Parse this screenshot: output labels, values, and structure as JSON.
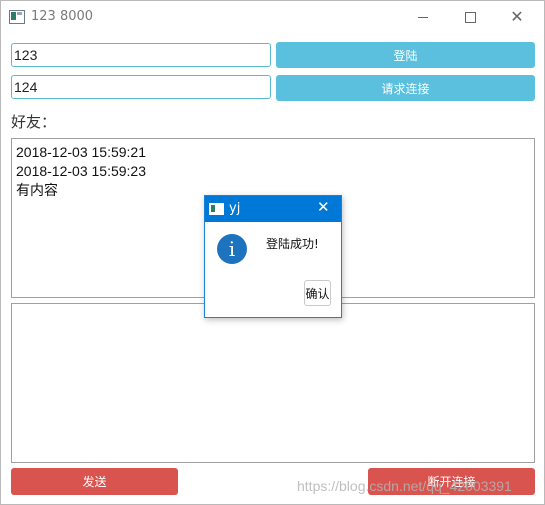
{
  "window": {
    "title": "123 8000",
    "minimize_icon": "minimize-icon",
    "maximize_icon": "maximize-icon",
    "close_icon": "close-icon",
    "close_glyph": "✕"
  },
  "form": {
    "username_value": "123",
    "target_value": "124",
    "login_label": "登陆",
    "connect_label": "请求连接",
    "friends_label": "好友："
  },
  "messages": {
    "lines": [
      "2018-12-03 15:59:21",
      "2018-12-03 15:59:23",
      "有内容"
    ]
  },
  "compose": {
    "text": ""
  },
  "actions": {
    "send_label": "发送",
    "disconnect_label": "断开连接"
  },
  "watermark": {
    "text": "https://blog.csdn.net/qq_42003391"
  },
  "dialog": {
    "title": "yj",
    "close_glyph": "✕",
    "icon": "info-icon",
    "icon_glyph": "i",
    "message": "登陆成功!",
    "ok_label": "确认"
  },
  "colors": {
    "accent_blue": "#5bc0de",
    "danger_red": "#d9534f",
    "dialog_title": "#0078d7"
  }
}
